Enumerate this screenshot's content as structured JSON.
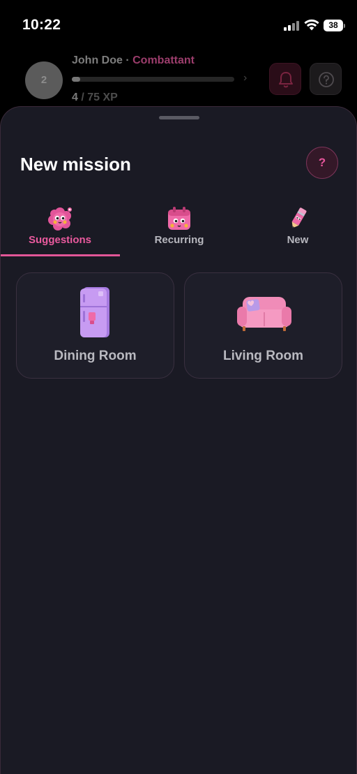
{
  "status_bar": {
    "time": "10:22",
    "battery": "38"
  },
  "profile": {
    "avatar_level": "2",
    "name": "John Doe",
    "separator": " · ",
    "rank": "Combattant",
    "xp_current": "4",
    "xp_separator": " / ",
    "xp_max": "75 XP",
    "xp_progress": 0.053,
    "bell_icon": "bell-icon",
    "help_icon": "question-circle-icon"
  },
  "sheet": {
    "title": "New mission",
    "help_label": "?",
    "tabs": [
      {
        "label": "Suggestions",
        "icon": "flower-face-icon",
        "active": true
      },
      {
        "label": "Recurring",
        "icon": "calendar-face-icon",
        "active": false
      },
      {
        "label": "New",
        "icon": "pencil-icon",
        "active": false
      }
    ],
    "rooms": [
      {
        "label": "Dining Room",
        "icon": "fridge-icon"
      },
      {
        "label": "Living Room",
        "icon": "sofa-icon"
      }
    ]
  },
  "colors": {
    "accent": "#e25697",
    "sheet_bg": "#1a1a24",
    "card_bg": "#1e1e29"
  }
}
